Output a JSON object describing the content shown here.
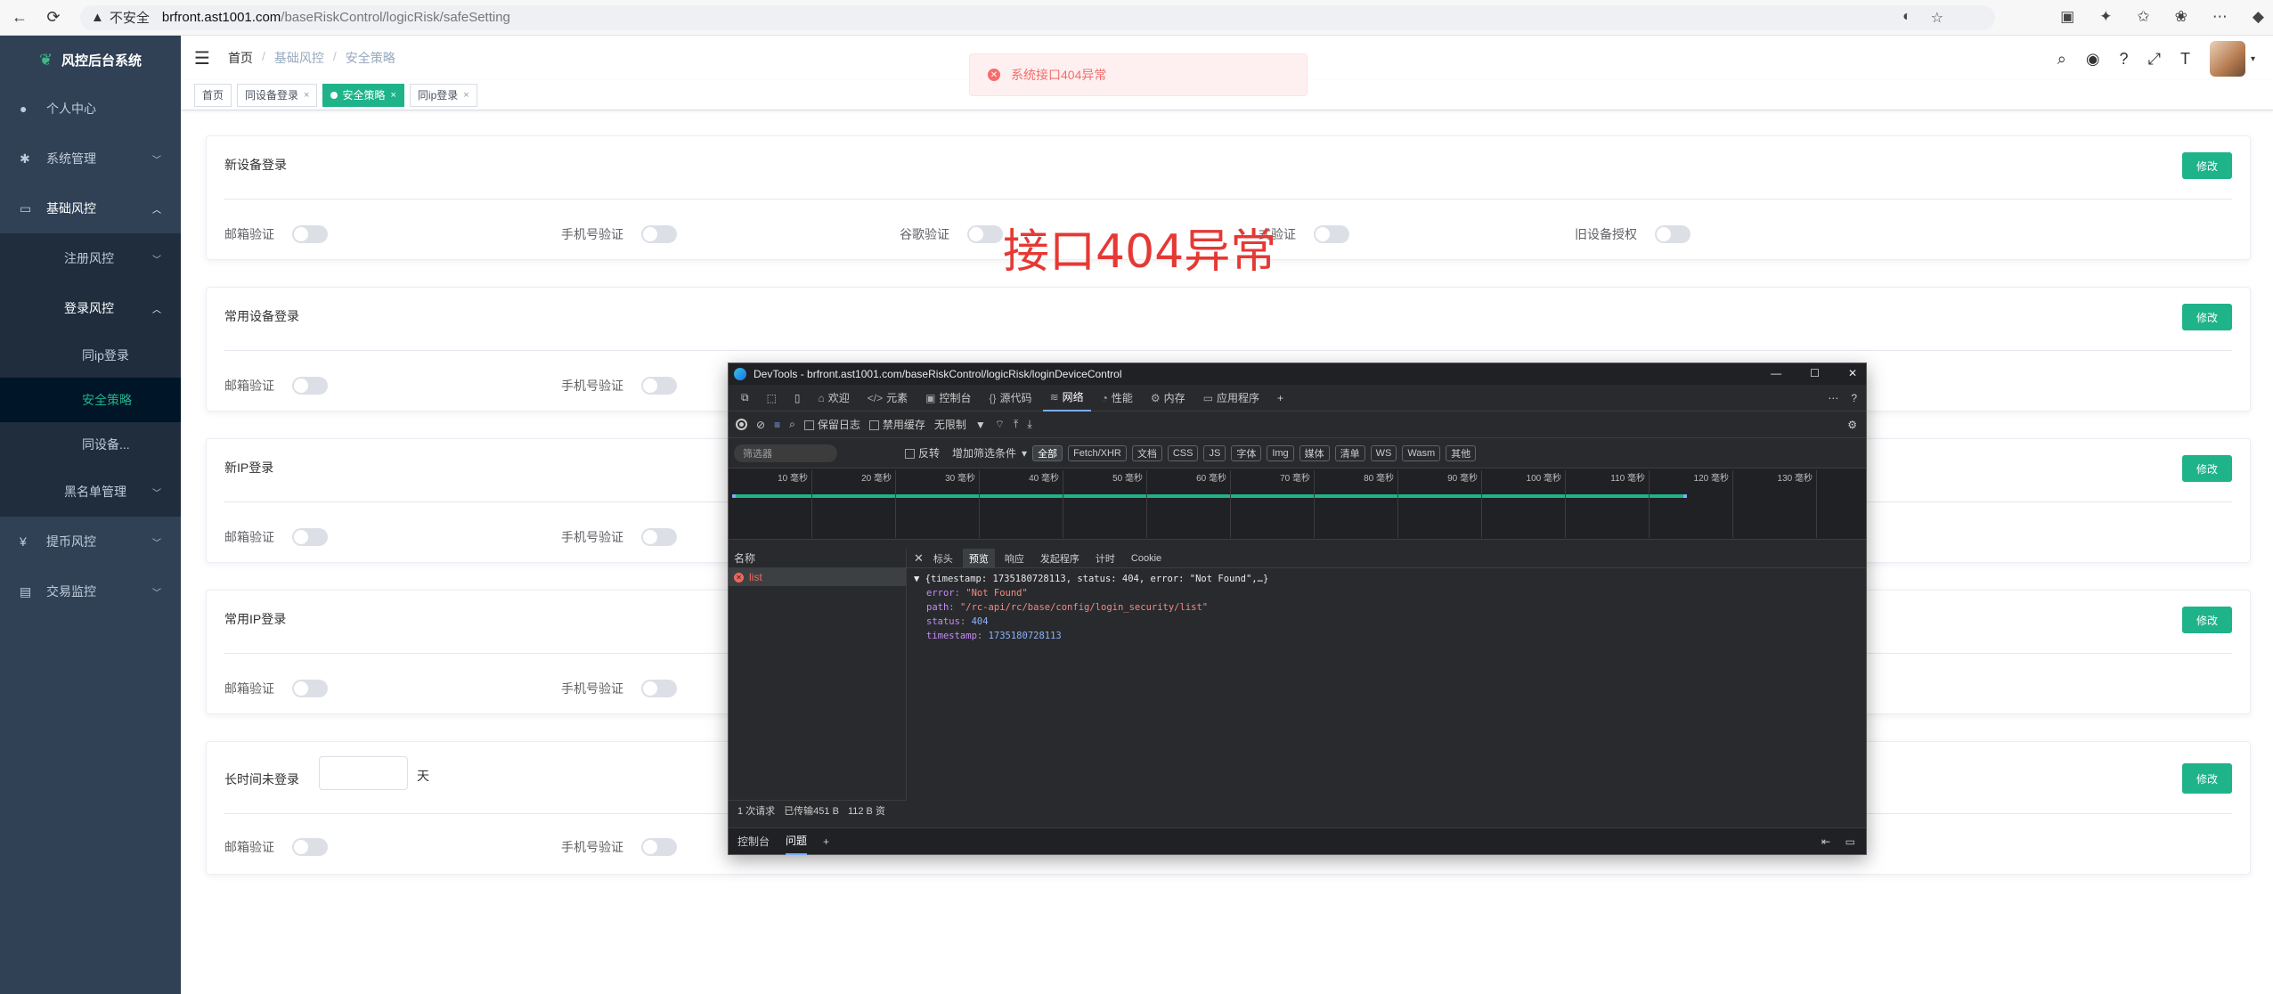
{
  "browser": {
    "insecure_label": "不安全",
    "url_host": "brfront.ast1001.com",
    "url_path": "/baseRiskControl/logicRisk/safeSetting"
  },
  "sidebar": {
    "logo_text": "风控后台系统",
    "items": [
      {
        "label": "个人中心"
      },
      {
        "label": "系统管理"
      },
      {
        "label": "基础风控"
      },
      {
        "label": "注册风控"
      },
      {
        "label": "登录风控"
      },
      {
        "label": "同ip登录"
      },
      {
        "label": "安全策略"
      },
      {
        "label": "同设备..."
      },
      {
        "label": "黑名单管理"
      },
      {
        "label": "提币风控"
      },
      {
        "label": "交易监控"
      }
    ]
  },
  "breadcrumb": [
    "首页",
    "基础风控",
    "安全策略"
  ],
  "tags": [
    {
      "label": "首页"
    },
    {
      "label": "同设备登录"
    },
    {
      "label": "安全策略"
    },
    {
      "label": "同ip登录"
    }
  ],
  "toast": {
    "message": "系统接口404异常"
  },
  "overlay_text": "接口404异常",
  "cards": [
    {
      "title": "新设备登录",
      "edit": "修改",
      "options": [
        "邮箱验证",
        "手机号验证",
        "谷歌验证",
        "式验证",
        "旧设备授权"
      ]
    },
    {
      "title": "常用设备登录",
      "edit": "修改",
      "options": [
        "邮箱验证",
        "手机号验证"
      ]
    },
    {
      "title": "新IP登录",
      "edit": "修改",
      "options": [
        "邮箱验证",
        "手机号验证"
      ]
    },
    {
      "title": "常用IP登录",
      "edit": "修改",
      "options": [
        "邮箱验证",
        "手机号验证"
      ]
    },
    {
      "title": "长时间未登录",
      "edit": "修改",
      "unit": "天",
      "options": [
        "邮箱验证",
        "手机号验证"
      ]
    }
  ],
  "devtools": {
    "title": "DevTools - brfront.ast1001.com/baseRiskControl/logicRisk/loginDeviceControl",
    "tabs": [
      "欢迎",
      "元素",
      "控制台",
      "源代码",
      "网络",
      "性能",
      "内存",
      "应用程序"
    ],
    "toolbar": {
      "preserve_log": "保留日志",
      "disable_cache": "禁用缓存",
      "throttle": "无限制"
    },
    "filter": {
      "placeholder": "筛选器",
      "invert": "反转",
      "more_filters": "增加筛选条件",
      "types": [
        "全部",
        "Fetch/XHR",
        "文档",
        "CSS",
        "JS",
        "字体",
        "Img",
        "媒体",
        "清单",
        "WS",
        "Wasm",
        "其他"
      ]
    },
    "timeline_ticks": [
      "10 毫秒",
      "20 毫秒",
      "30 毫秒",
      "40 毫秒",
      "50 毫秒",
      "60 毫秒",
      "70 毫秒",
      "80 毫秒",
      "90 毫秒",
      "100 毫秒",
      "110 毫秒",
      "120 毫秒",
      "130 毫秒"
    ],
    "name_header": "名称",
    "request_name": "list",
    "detail_tabs": [
      "标头",
      "预览",
      "响应",
      "发起程序",
      "计时",
      "Cookie"
    ],
    "preview": {
      "summary": "{timestamp: 1735180728113, status: 404, error: \"Not Found\",…}",
      "error_key": "error",
      "error_val": "\"Not Found\"",
      "path_key": "path",
      "path_val": "\"/rc-api/rc/base/config/login_security/list\"",
      "status_key": "status",
      "status_val": "404",
      "timestamp_key": "timestamp",
      "timestamp_val": "1735180728113"
    },
    "status": {
      "requests": "1 次请求",
      "transferred": "已传输451 B",
      "size": "112 B 资"
    },
    "drawer_tabs": [
      "控制台",
      "问题"
    ]
  }
}
